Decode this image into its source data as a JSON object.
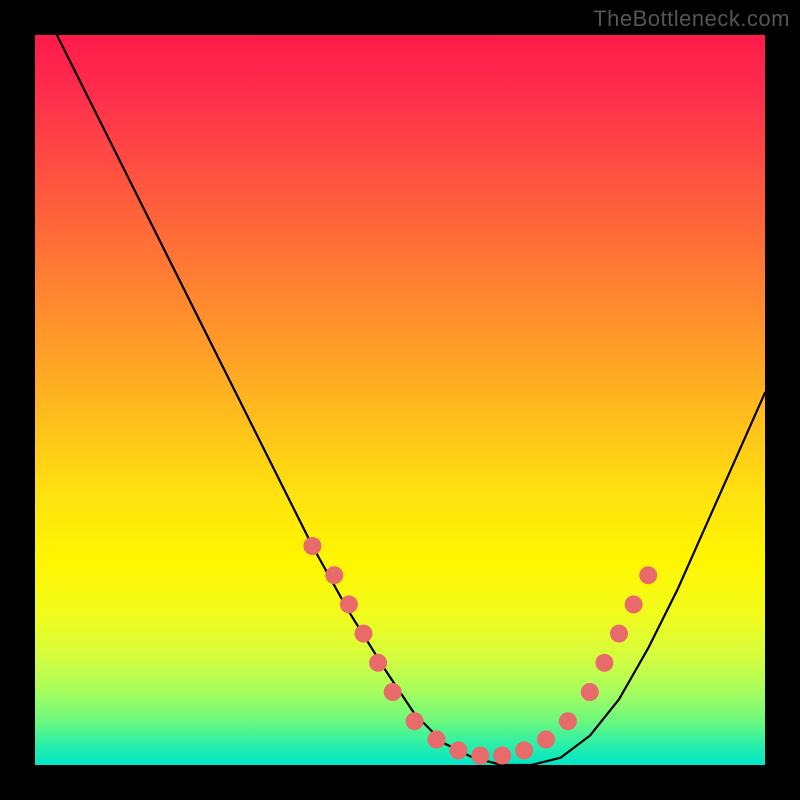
{
  "watermark": "TheBottleneck.com",
  "colors": {
    "marker": "#e86a6a",
    "line": "#000000",
    "background": "#000000"
  },
  "chart_data": {
    "type": "line",
    "title": "",
    "xlabel": "",
    "ylabel": "",
    "xlim": [
      0,
      100
    ],
    "ylim": [
      0,
      100
    ],
    "grid": false,
    "legend": false,
    "series": [
      {
        "name": "curve",
        "x": [
          3,
          8,
          13,
          18,
          23,
          28,
          33,
          38,
          43,
          48,
          52,
          56,
          60,
          64,
          68,
          72,
          76,
          80,
          84,
          88,
          92,
          96,
          100
        ],
        "y": [
          100,
          90,
          80,
          70,
          60,
          50,
          40,
          30,
          21,
          13,
          7,
          3,
          1,
          0,
          0,
          1,
          4,
          9,
          16,
          24,
          33,
          42,
          51
        ]
      }
    ],
    "markers": [
      {
        "x": 38,
        "y": 30
      },
      {
        "x": 41,
        "y": 26
      },
      {
        "x": 43,
        "y": 22
      },
      {
        "x": 45,
        "y": 18
      },
      {
        "x": 47,
        "y": 14
      },
      {
        "x": 49,
        "y": 10
      },
      {
        "x": 52,
        "y": 6
      },
      {
        "x": 55,
        "y": 3.5
      },
      {
        "x": 58,
        "y": 2
      },
      {
        "x": 61,
        "y": 1.3
      },
      {
        "x": 64,
        "y": 1.3
      },
      {
        "x": 67,
        "y": 2
      },
      {
        "x": 70,
        "y": 3.5
      },
      {
        "x": 73,
        "y": 6
      },
      {
        "x": 76,
        "y": 10
      },
      {
        "x": 78,
        "y": 14
      },
      {
        "x": 80,
        "y": 18
      },
      {
        "x": 82,
        "y": 22
      },
      {
        "x": 84,
        "y": 26
      }
    ]
  }
}
